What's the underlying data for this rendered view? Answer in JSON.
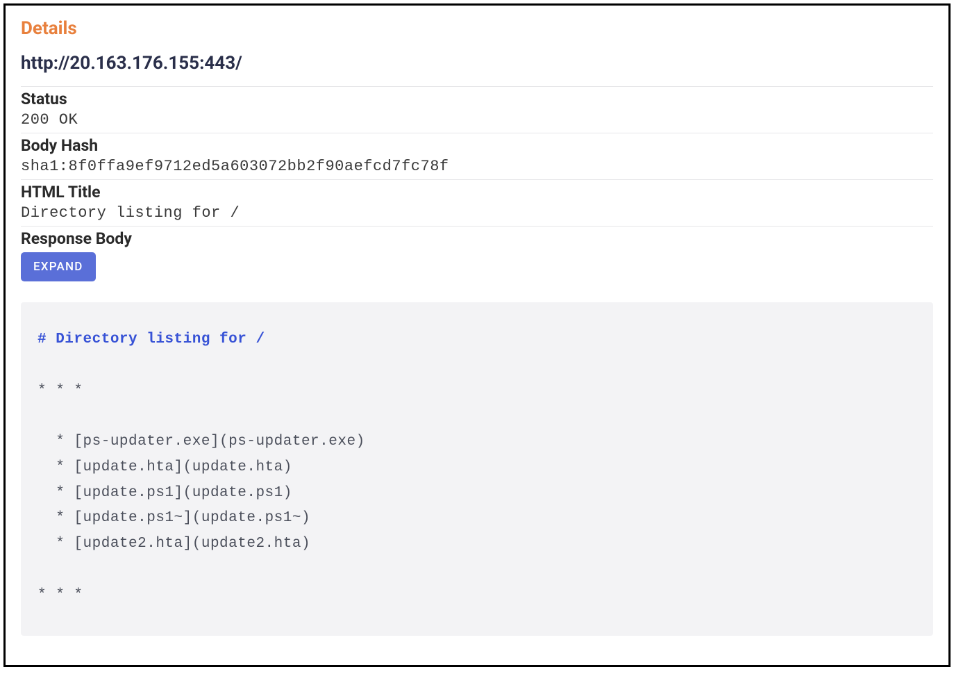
{
  "header": {
    "title": "Details",
    "url": "http://20.163.176.155:443/"
  },
  "sections": {
    "status": {
      "label": "Status",
      "value": "200 OK"
    },
    "body_hash": {
      "label": "Body Hash",
      "value": "sha1:8f0ffa9ef9712ed5a603072bb2f90aefcd7fc78f"
    },
    "html_title": {
      "label": "HTML Title",
      "value": "Directory listing for /"
    },
    "response_body": {
      "label": "Response Body",
      "expand_label": "EXPAND"
    }
  },
  "response": {
    "heading": "# Directory listing for /",
    "divider1": "* * *",
    "items": [
      "  * [ps-updater.exe](ps-updater.exe)",
      "  * [update.hta](update.hta)",
      "  * [update.ps1](update.ps1)",
      "  * [update.ps1~](update.ps1~)",
      "  * [update2.hta](update2.hta)"
    ],
    "divider2": "* * *"
  }
}
